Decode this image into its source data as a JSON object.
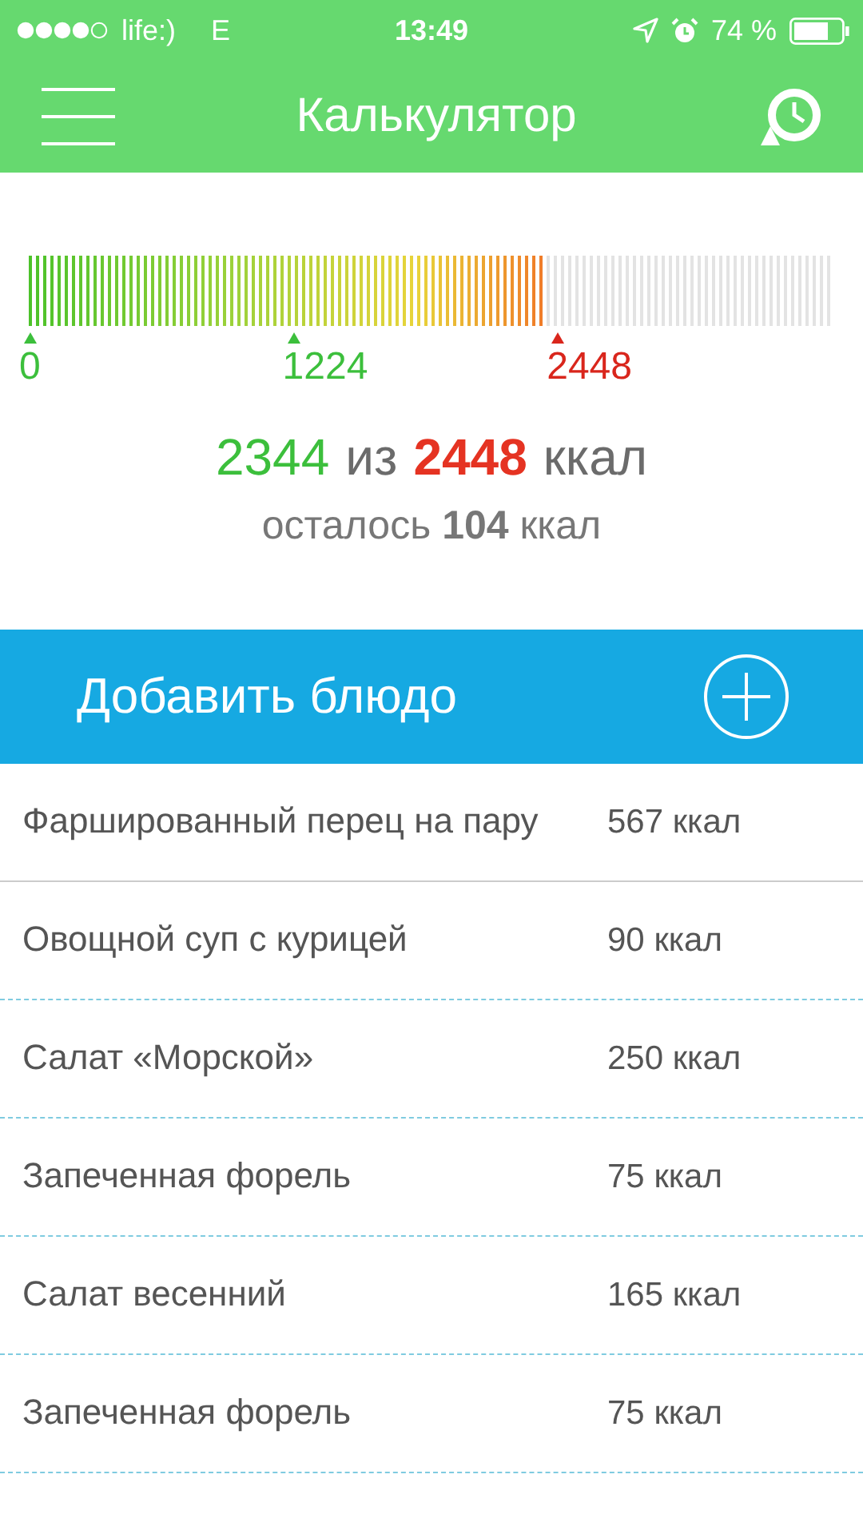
{
  "status_bar": {
    "carrier": "life:)",
    "network": "E",
    "time": "13:49",
    "battery": "74 %"
  },
  "header": {
    "title": "Калькулятор"
  },
  "gauge": {
    "level": 0.64,
    "ticks": [
      {
        "label": "0",
        "color": "#3cbf3c"
      },
      {
        "label": "1224",
        "color": "#3cbf3c"
      },
      {
        "label": "2448",
        "color": "#d9261c"
      }
    ]
  },
  "summary": {
    "eaten": "2344",
    "of": "из",
    "goal": "2448",
    "unit": "ккал",
    "remaining": "осталось **104** ккал"
  },
  "add_button": {
    "label": "Добавить блюдо"
  },
  "meals": [
    {
      "name": "Фаршированный перец на пару",
      "calories": "567 ккал"
    },
    {
      "name": "Овощной суп с курицей",
      "calories": "90 ккал"
    },
    {
      "name": "Салат «Морской»",
      "calories": "250 ккал"
    },
    {
      "name": "Запеченная форель",
      "calories": "75 ккал"
    },
    {
      "name": "Салат весенний",
      "calories": "165 ккал"
    },
    {
      "name": "Запеченная форель",
      "calories": "75 ккал"
    }
  ]
}
